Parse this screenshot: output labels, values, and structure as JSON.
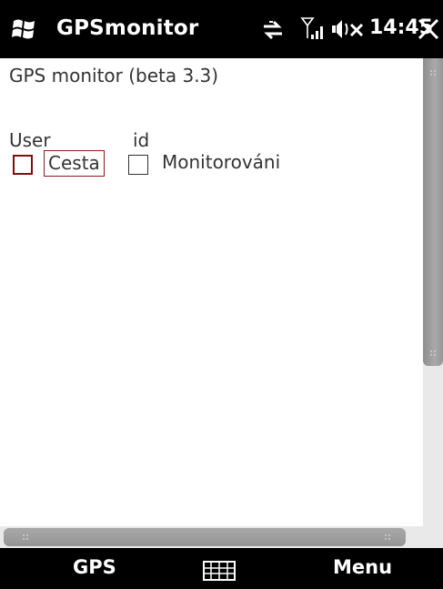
{
  "titlebar": {
    "app_name": "GPSmonitor",
    "time": "14:45",
    "icons": [
      "windows-logo-icon",
      "sync-icon",
      "signal-icon",
      "volume-muted-icon",
      "close-icon"
    ]
  },
  "content": {
    "app_title": "GPS monitor (beta 3.3)",
    "user_label": "User",
    "id_label": "id",
    "checkboxes": [
      {
        "label": "Cesta",
        "checked": false,
        "focused": true
      },
      {
        "label": "Monitorováni",
        "checked": false,
        "focused": false
      }
    ]
  },
  "softkeys": {
    "left": "GPS",
    "center_icon": "keyboard-icon",
    "right": "Menu"
  },
  "colors": {
    "bar_background": "#000000",
    "focus_border": "#8b1a1a",
    "scrollbar_thumb": "#9a9a9a",
    "scrollbar_track": "#e9e9e9"
  }
}
